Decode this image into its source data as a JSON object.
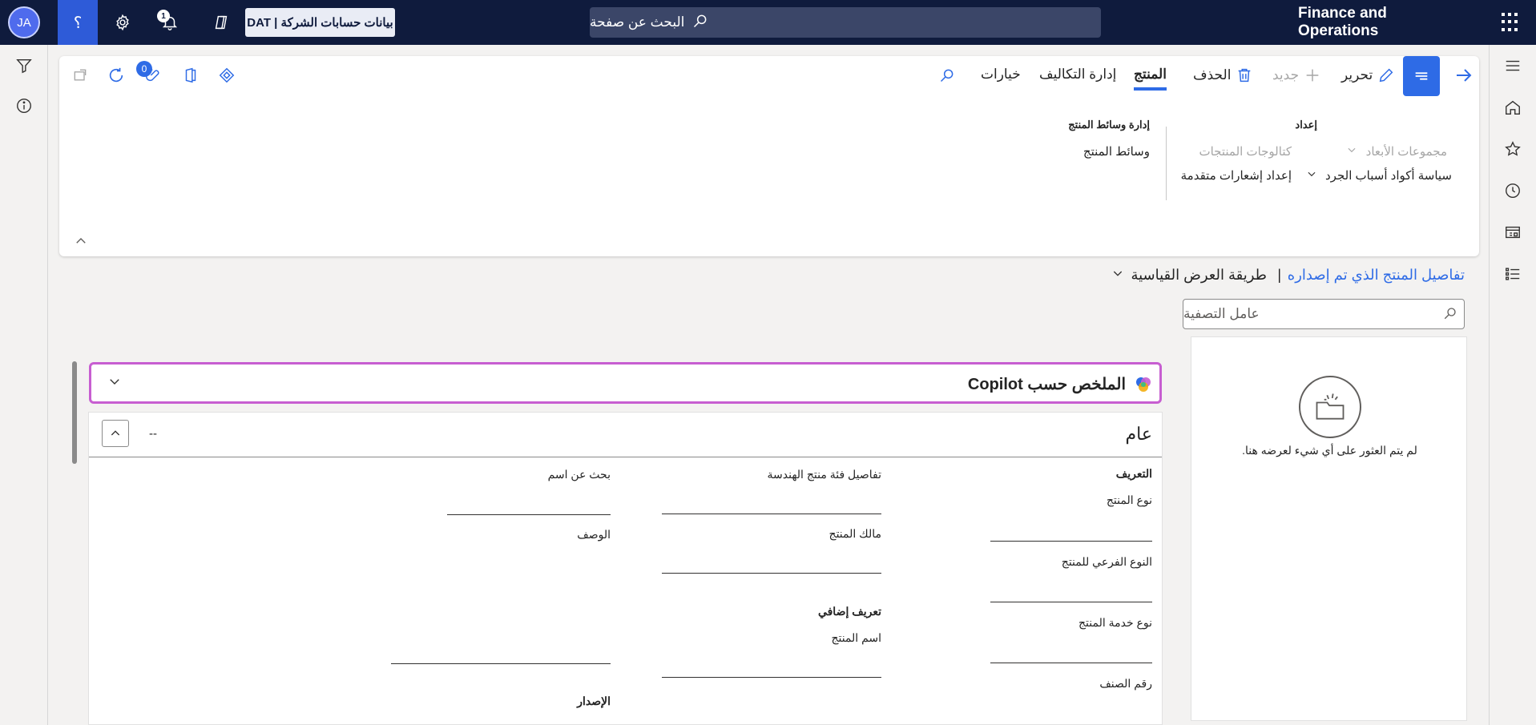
{
  "topbar": {
    "avatar_initials": "JA",
    "help_label": "؟",
    "notification_count": "1",
    "company_label": "بيانات حسابات الشركة | DAT",
    "search_placeholder": "البحث عن صفحة",
    "app_name": "Finance and Operations"
  },
  "actions": {
    "edit": "تحرير",
    "new": "جديد",
    "delete": "الحذف",
    "tab_product": "المنتج",
    "tab_cost": "إدارة التكاليف",
    "tab_options": "خيارات",
    "attachments_count": "0"
  },
  "groups": {
    "setup": {
      "title": "إعداد",
      "items": [
        "مجموعات الأبعاد",
        "كتالوجات المنتجات",
        "سياسة أكواد أسباب الجرد",
        "إعداد إشعارات متقدمة"
      ]
    },
    "media": {
      "title": "إدارة وسائط المنتج",
      "items": [
        "وسائط المنتج"
      ]
    }
  },
  "page": {
    "breadcrumb_link": "تفاصيل المنتج الذي تم إصداره",
    "separator": "|",
    "view": "طريقة العرض القياسية"
  },
  "sidepanel": {
    "filter_placeholder": "عامل التصفية",
    "empty_text": "لم يتم العثور على أي شيء لعرضه هنا."
  },
  "copilot": {
    "title": "الملخص حسب Copilot"
  },
  "general": {
    "title": "عام",
    "summary": "--",
    "col1": {
      "header": "التعريف",
      "fields": [
        "نوع المنتج",
        "النوع الفرعي للمنتج",
        "نوع خدمة المنتج",
        "رقم الصنف"
      ]
    },
    "col2": {
      "fields": [
        "تفاصيل فئة منتج الهندسة",
        "مالك المنتج"
      ],
      "subheader": "تعريف إضافي",
      "subfields": [
        "اسم المنتج"
      ]
    },
    "col3": {
      "fields": [
        "بحث عن اسم",
        "الوصف"
      ],
      "subheader": "الإصدار"
    }
  },
  "colors": {
    "topbar": "#0f1b3d",
    "accent": "#2e6be6",
    "copilot_border": "#c75ed1"
  }
}
